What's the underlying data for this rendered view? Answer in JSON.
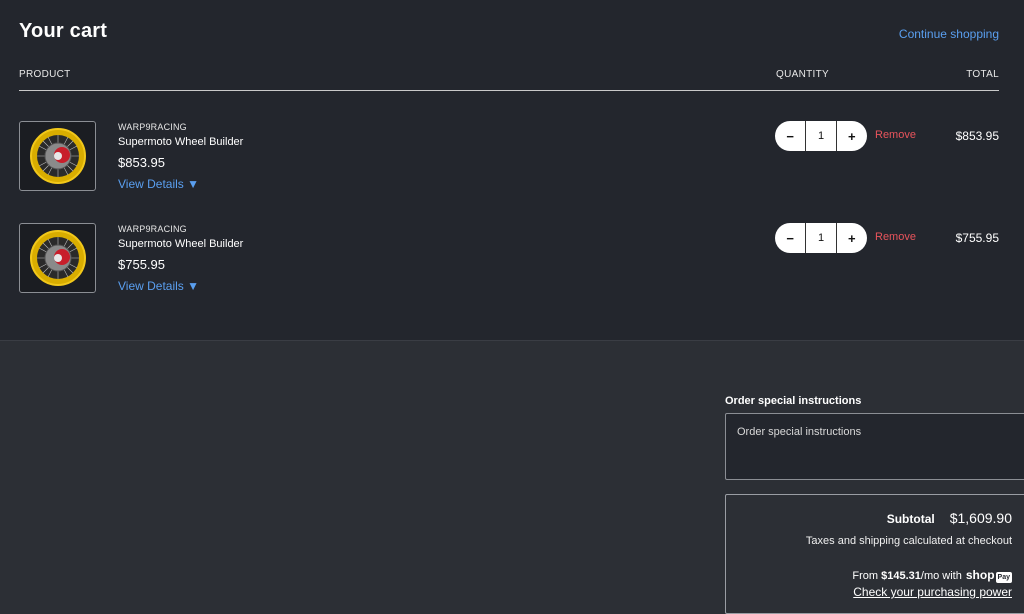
{
  "header": {
    "title": "Your cart",
    "continue_label": "Continue shopping"
  },
  "columns": {
    "product": "PRODUCT",
    "quantity": "QUANTITY",
    "total": "TOTAL"
  },
  "items": [
    {
      "vendor": "WARP9RACING",
      "name": "Supermoto Wheel Builder",
      "price": "$853.95",
      "details_label": "View Details ▼",
      "quantity": "1",
      "decrement": "−",
      "increment": "+",
      "remove_label": "Remove",
      "line_total": "$853.95",
      "thumbnail_icon": "wheel-image"
    },
    {
      "vendor": "WARP9RACING",
      "name": "Supermoto Wheel Builder",
      "price": "$755.95",
      "details_label": "View Details ▼",
      "quantity": "1",
      "decrement": "−",
      "increment": "+",
      "remove_label": "Remove",
      "line_total": "$755.95",
      "thumbnail_icon": "wheel-image"
    }
  ],
  "instructions": {
    "label": "Order special instructions",
    "placeholder": "Order special instructions"
  },
  "summary": {
    "subtotal_label": "Subtotal",
    "subtotal_value": "$1,609.90",
    "tax_note": "Taxes and shipping calculated at checkout",
    "installment_prefix": "From ",
    "installment_amount": "$145.31",
    "installment_suffix": "/mo with",
    "shop_label": "shop",
    "pay_label": "Pay",
    "purchasing_power_label": "Check your purchasing power"
  },
  "colors": {
    "top_background": "#23262d",
    "page_background": "#2c2f35",
    "link": "#5a9ff0",
    "remove": "#e9545c",
    "wheel_rim": "#e0b400"
  }
}
